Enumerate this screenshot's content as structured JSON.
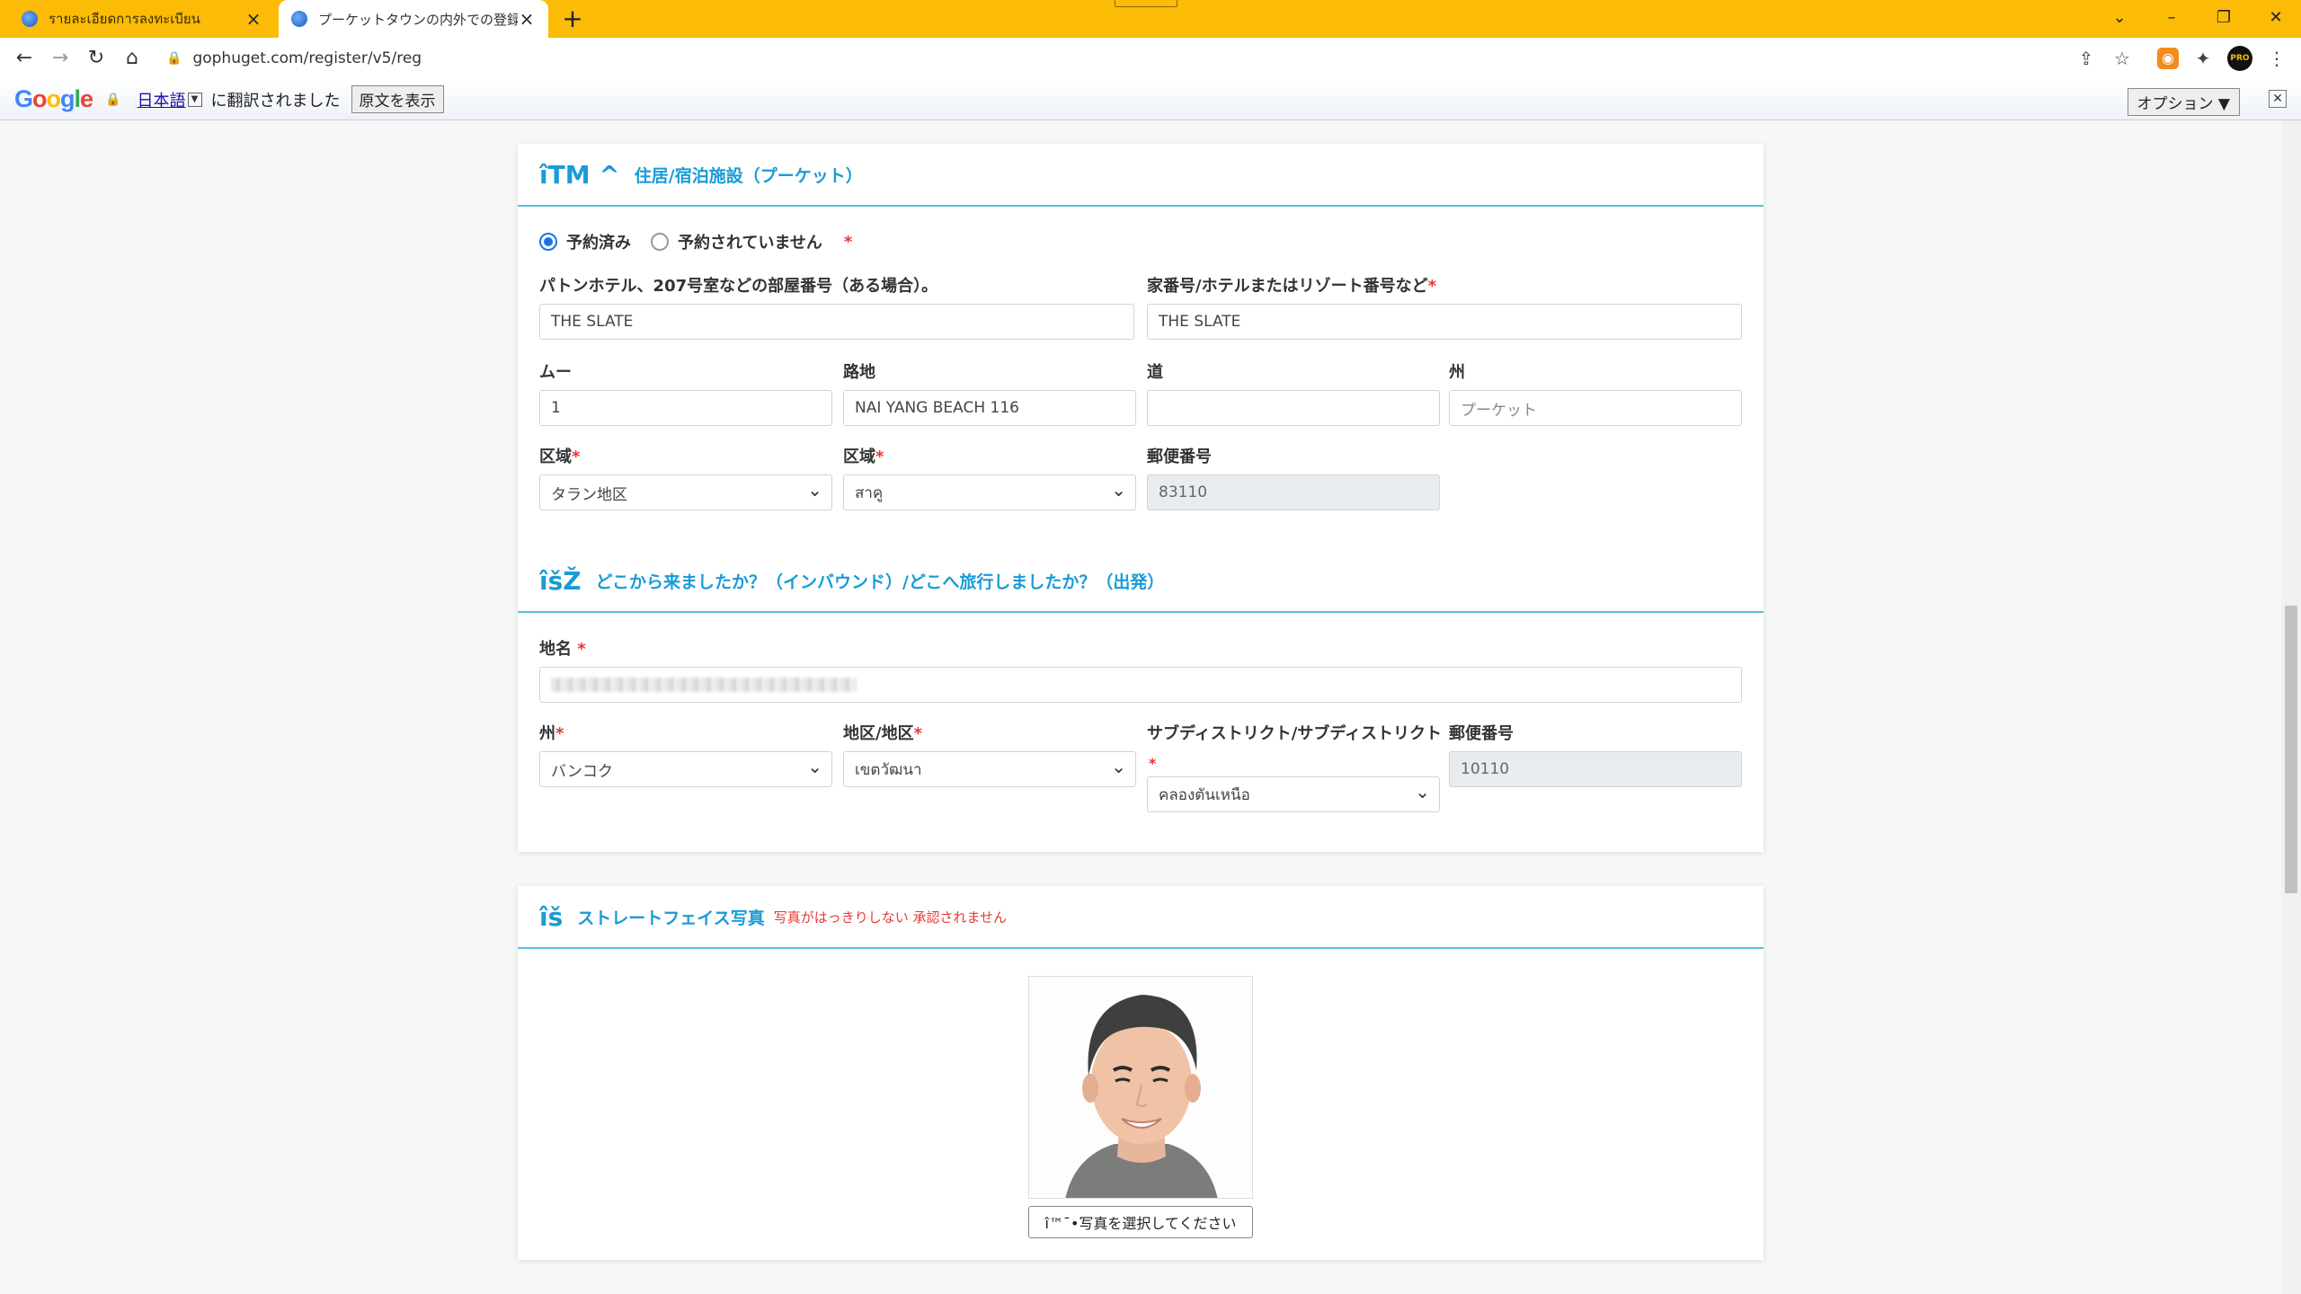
{
  "browser": {
    "tabs": [
      {
        "title": "รายละเอียดการลงทะเบียน",
        "active": false
      },
      {
        "title": "プーケットタウンの内外での登録",
        "active": true
      }
    ],
    "url": "gophuget.com/register/v5/reg",
    "avatar_text": "PRO"
  },
  "translate_bar": {
    "logo": "Google",
    "language": "日本語",
    "message": "に翻訳されました",
    "show_original": "原文を表示",
    "options": "オプション ▼"
  },
  "residence": {
    "icon": "îTM ^",
    "title": "住居/宿泊施設（プーケット）",
    "radio_booked": "予約済み",
    "radio_not_booked": "予約されていません",
    "room_label": "パトンホテル、207号室などの部屋番号（ある場合）。",
    "room_value": "THE SLATE",
    "house_label": "家番号/ホテルまたはリゾート番号など",
    "house_value": "THE SLATE",
    "moo_label": "ムー",
    "moo_value": "1",
    "soi_label": "路地",
    "soi_value": "NAI YANG BEACH 116",
    "road_label": "道",
    "road_value": "",
    "province_label": "州",
    "province_placeholder": "プーケット",
    "district_label": "区域",
    "district_value": "タラン地区",
    "subdistrict_label": "区域",
    "subdistrict_value": "สาคู",
    "postal_label": "郵便番号",
    "postal_value": "83110"
  },
  "origin": {
    "icon": "îšŽ",
    "title": "どこから来ましたか？（インバウンド）/どこへ旅行しましたか？（出発）",
    "place_label": "地名",
    "province_label": "州",
    "province_value": "バンコク",
    "district_label": "地区/地区",
    "district_value": "เขตวัฒนา",
    "subdistrict_label": "サブディストリクト/サブディストリクト",
    "subdistrict_value": "คลองตันเหนือ",
    "postal_label": "郵便番号",
    "postal_value": "10110"
  },
  "photo": {
    "icon": "îš",
    "title": "ストレートフェイス写真",
    "note": "写真がはっきりしない 承認されません",
    "button": "î™¯•写真を選択してください"
  }
}
